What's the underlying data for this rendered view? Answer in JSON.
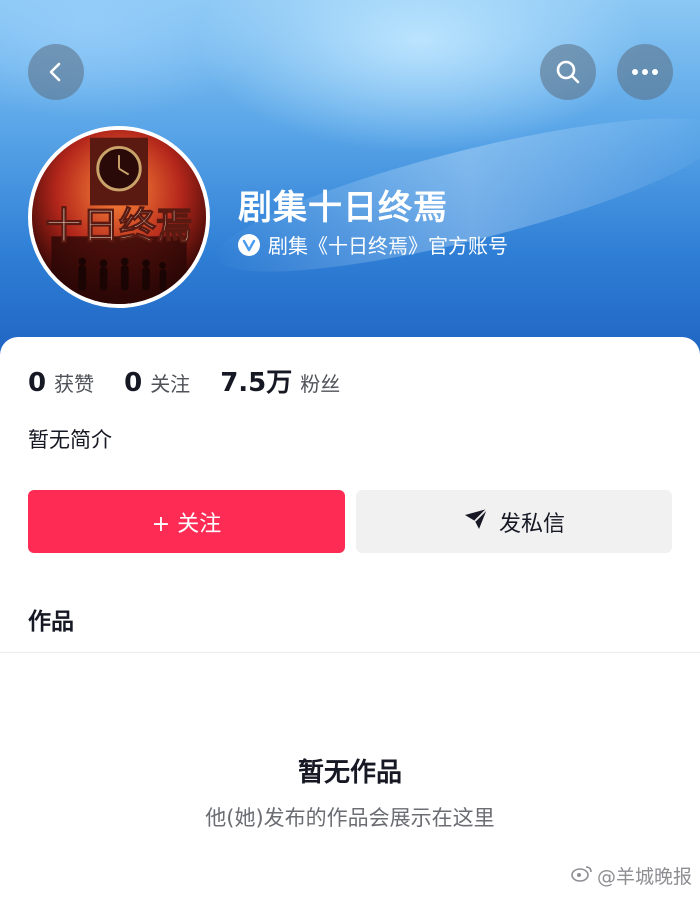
{
  "colors": {
    "accent": "#fe2c55",
    "header_blue": "#2f7fd6",
    "secondary_button": "#f1f1f2"
  },
  "header": {
    "back_icon": "chevron-left-icon",
    "search_icon": "search-icon",
    "more_icon": "more-horizontal-icon"
  },
  "profile": {
    "name": "剧集十日终焉",
    "verified_text": "剧集《十日终焉》官方账号",
    "avatar_text": "十日终焉"
  },
  "stats": [
    {
      "value": "0",
      "label": "获赞"
    },
    {
      "value": "0",
      "label": "关注"
    },
    {
      "value": "7.5万",
      "label": "粉丝"
    }
  ],
  "bio": "暂无简介",
  "actions": {
    "follow_label": "+ 关注",
    "message_label": "发私信"
  },
  "tabs": {
    "works_label": "作品"
  },
  "empty": {
    "title": "暂无作品",
    "subtitle": "他(她)发布的作品会展示在这里"
  },
  "watermark": {
    "text": "@羊城晚报"
  }
}
